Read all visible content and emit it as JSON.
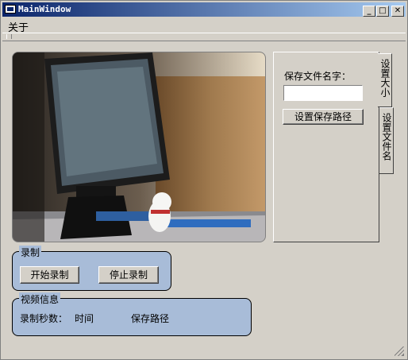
{
  "window": {
    "title": "MainWindow",
    "minimize": "_",
    "maximize": "□",
    "close": "✕"
  },
  "menu": {
    "about": "关于"
  },
  "tabs": {
    "save_file": {
      "filename_label": "保存文件名字：",
      "filename_value": "",
      "set_path_button": "设置保存路径"
    },
    "tab_size_label": "设置大小",
    "tab_file_label": "设置文件名"
  },
  "record_group": {
    "title": "录制",
    "start_button": "开始录制",
    "stop_button": "停止录制"
  },
  "info_group": {
    "title": "视频信息",
    "seconds_label": "录制秒数：",
    "time_label": "时间",
    "path_label": "保存路径"
  },
  "icons": {
    "app": "window-icon",
    "grip": "toolbar-grip-icon",
    "resize": "size-grip-icon"
  }
}
